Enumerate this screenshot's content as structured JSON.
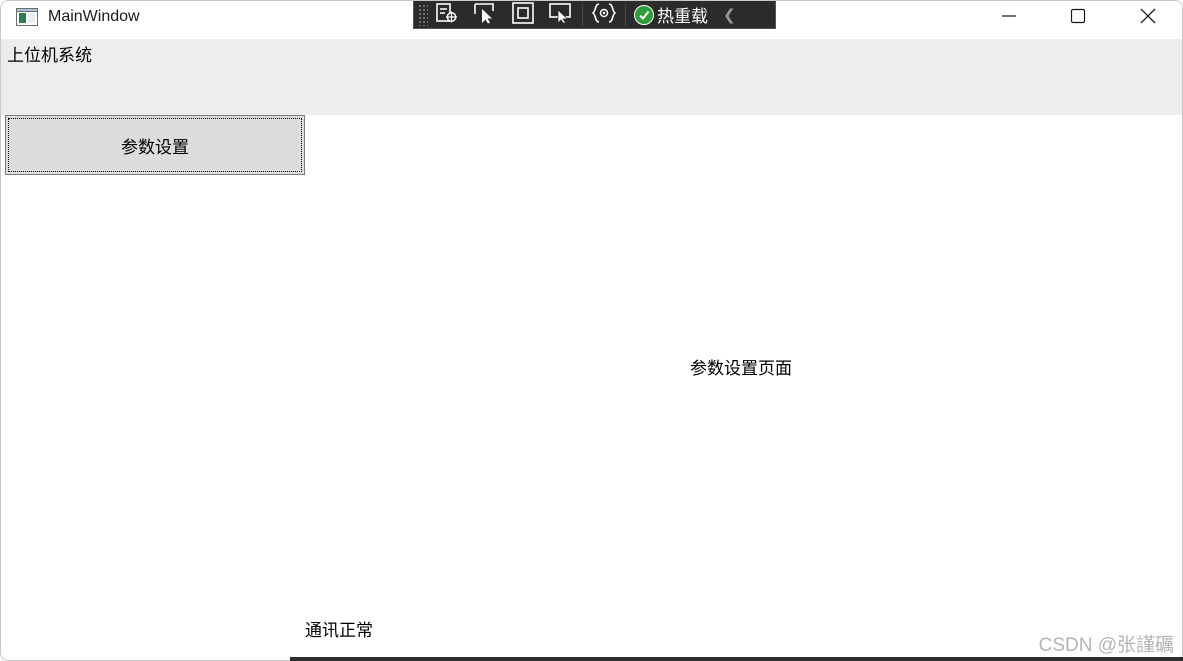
{
  "window": {
    "title": "MainWindow",
    "app_icon": "wpf-window-icon",
    "controls": {
      "minimize_icon": "minimize-icon",
      "maximize_icon": "maximize-icon",
      "close_icon": "close-icon"
    }
  },
  "debug_toolbar": {
    "tools": [
      {
        "icon": "select-element-icon"
      },
      {
        "icon": "pointer-select-icon"
      },
      {
        "icon": "layout-adorners-icon"
      },
      {
        "icon": "track-focus-icon"
      },
      {
        "icon": "binding-failures-icon"
      }
    ],
    "hot_reload_label": "热重载",
    "hot_reload_status_icon": "check-circle-icon",
    "collapse_icon": "chevron-left-icon"
  },
  "header": {
    "title": "上位机系统"
  },
  "nav": {
    "param_button_label": "参数设置"
  },
  "content": {
    "page_label": "参数设置页面"
  },
  "status": {
    "text": "通讯正常"
  },
  "watermark": "CSDN @张謹礪",
  "colors": {
    "header_bg": "#ededed",
    "button_bg": "#dddddd",
    "toolbar_bg": "#2b2b2b",
    "hot_reload_check": "#2e9d38"
  }
}
